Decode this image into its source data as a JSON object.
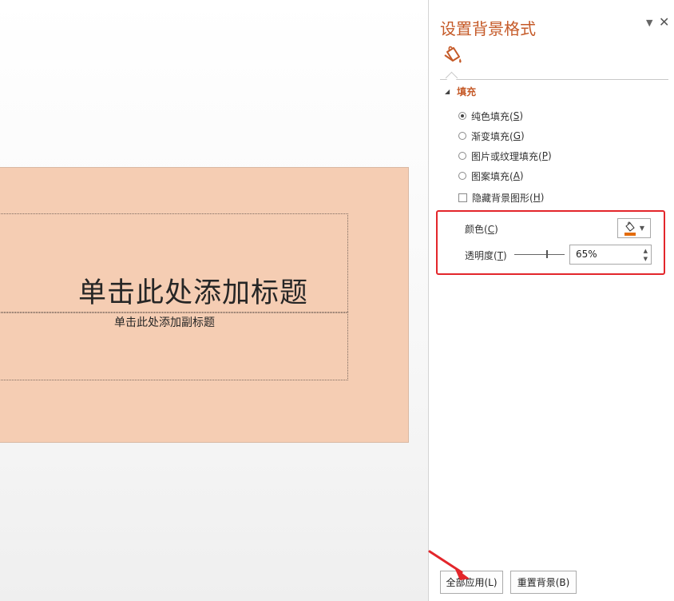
{
  "slide": {
    "title_placeholder": "单击此处添加标题",
    "subtitle_placeholder": "单击此处添加副标题",
    "background_color": "#f5cdb3"
  },
  "pane": {
    "title": "设置背景格式",
    "menu_icon": "chevron-down-icon",
    "close_icon": "close-icon",
    "tab_icon": "fill-bucket-icon",
    "section_fill": "填充",
    "options": [
      {
        "label_pre": "纯色填充(",
        "key": "S",
        "label_post": ")",
        "selected": true
      },
      {
        "label_pre": "渐变填充(",
        "key": "G",
        "label_post": ")",
        "selected": false
      },
      {
        "label_pre": "图片或纹理填充(",
        "key": "P",
        "label_post": ")",
        "selected": false
      },
      {
        "label_pre": "图案填充(",
        "key": "A",
        "label_post": ")",
        "selected": false
      }
    ],
    "hide_graphics": {
      "label_pre": "隐藏背景图形(",
      "key": "H",
      "label_post": ")",
      "checked": false
    },
    "color": {
      "label_pre": "颜色(",
      "key": "C",
      "label_post": ")",
      "swatch": "#e46c0a"
    },
    "transparency": {
      "label_pre": "透明度(",
      "key": "T",
      "label_post": ")",
      "value": "65%",
      "level": 0.65
    },
    "apply_all": "全部应用(L)",
    "reset_bg": "重置背景(B)",
    "accent_color": "#c55a28",
    "highlight_color": "#e3262b"
  }
}
